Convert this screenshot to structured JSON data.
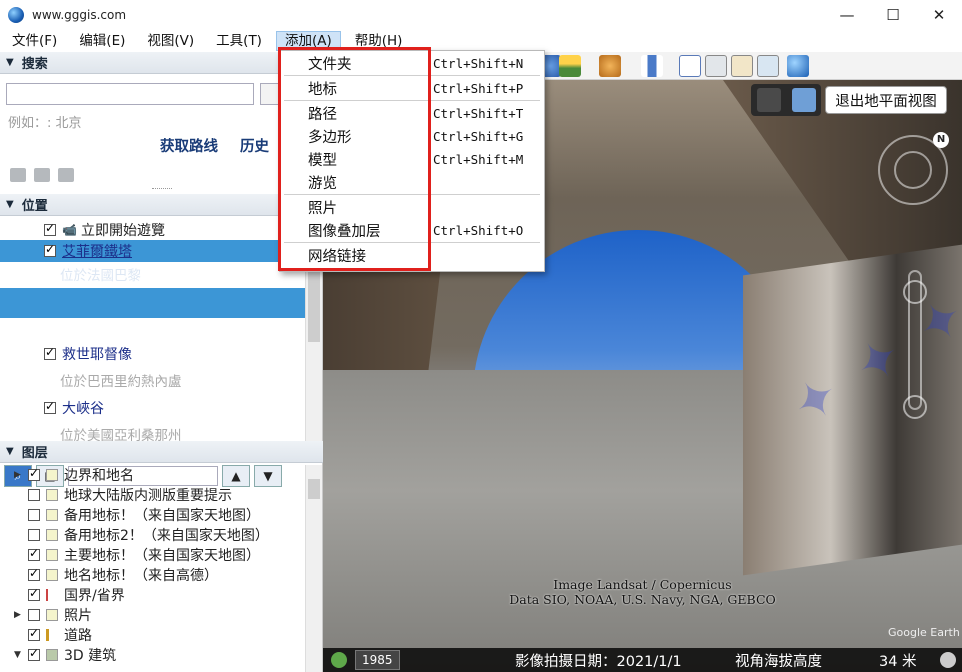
{
  "window": {
    "title": "www.gggis.com",
    "minimize": "—",
    "maximize": "☐",
    "close": "✕"
  },
  "menubar": [
    {
      "label": "文件(F)"
    },
    {
      "label": "编辑(E)"
    },
    {
      "label": "视图(V)"
    },
    {
      "label": "工具(T)"
    },
    {
      "label": "添加(A)"
    },
    {
      "label": "帮助(H)"
    }
  ],
  "search": {
    "header": "搜索",
    "hint": "例如：: 北京",
    "get_route": "获取路线",
    "history": "历史"
  },
  "places": {
    "header": "位置",
    "items": [
      {
        "label": "立即開始遊覽",
        "checked": true
      },
      {
        "label": "艾菲爾鐵塔",
        "checked": true,
        "sub": "位於法國巴黎"
      },
      {
        "label": "救世耶督像",
        "checked": true,
        "sub": "位於巴西里約熱內盧"
      },
      {
        "label": "大峽谷",
        "checked": true,
        "sub": "位於美國亞利桑那州"
      }
    ]
  },
  "layers": {
    "header": "图层",
    "items": [
      {
        "label": "边界和地名",
        "checked": true,
        "expand": true
      },
      {
        "label": "地球大陆版内测版重要提示",
        "checked": false,
        "expand": false
      },
      {
        "label": "备用地标！（来自国家天地图）",
        "checked": false,
        "expand": false
      },
      {
        "label": "备用地标2！（来自国家天地图）",
        "checked": false,
        "expand": false
      },
      {
        "label": "主要地标！（来自国家天地图）",
        "checked": true,
        "expand": false
      },
      {
        "label": "地名地标！（来自高德）",
        "checked": true,
        "expand": false
      },
      {
        "label": "国界/省界",
        "checked": true,
        "expand": false
      },
      {
        "label": "照片",
        "checked": false,
        "expand": true
      },
      {
        "label": "道路",
        "checked": true,
        "expand": false
      },
      {
        "label": "3D 建筑",
        "checked": true,
        "expand": true
      }
    ]
  },
  "add_menu": {
    "items": [
      {
        "label": "文件夹",
        "shortcut": "Ctrl+Shift+N"
      },
      {
        "label": "地标",
        "shortcut": "Ctrl+Shift+P"
      },
      {
        "label": "路径",
        "shortcut": "Ctrl+Shift+T"
      },
      {
        "label": "多边形",
        "shortcut": "Ctrl+Shift+G"
      },
      {
        "label": "模型",
        "shortcut": "Ctrl+Shift+M"
      },
      {
        "label": "游览",
        "shortcut": ""
      },
      {
        "label": "照片",
        "shortcut": ""
      },
      {
        "label": "图像叠加层",
        "shortcut": "Ctrl+Shift+O"
      },
      {
        "label": "网络链接",
        "shortcut": ""
      }
    ]
  },
  "view": {
    "exit_ground_view": "退出地平面视图",
    "north": "N",
    "credit_line1": "Image Landsat / Copernicus",
    "credit_line2": "Data SIO, NOAA, U.S. Navy, NGA, GEBCO",
    "brand": "Google Earth"
  },
  "status": {
    "year": "1985",
    "image_date": "影像拍摄日期：2021/1/1",
    "eye_alt": "视角海拔高度",
    "scale": "34 米"
  },
  "colors": {
    "selection": "#3c96d6",
    "highlight_box": "#e0201c",
    "link": "#1c2f8a"
  }
}
